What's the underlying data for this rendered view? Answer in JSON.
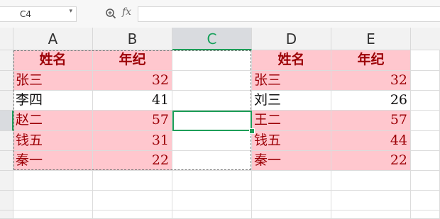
{
  "formula_bar": {
    "name_box": "C4",
    "fx_label": "fx",
    "formula": ""
  },
  "columns": [
    "A",
    "B",
    "C",
    "D",
    "E"
  ],
  "selected_cell": "C4",
  "table_left": {
    "headers": [
      "姓名",
      "年纪"
    ],
    "rows": [
      {
        "name": "张三",
        "age": "32",
        "highlight": true
      },
      {
        "name": "李四",
        "age": "41",
        "highlight": false
      },
      {
        "name": "赵二",
        "age": "57",
        "highlight": true
      },
      {
        "name": "钱五",
        "age": "31",
        "highlight": true
      },
      {
        "name": "秦一",
        "age": "22",
        "highlight": true
      }
    ]
  },
  "table_right": {
    "headers": [
      "姓名",
      "年纪"
    ],
    "rows": [
      {
        "name": "张三",
        "age": "32",
        "highlight": true
      },
      {
        "name": "刘三",
        "age": "26",
        "highlight": false
      },
      {
        "name": "王二",
        "age": "57",
        "highlight": true
      },
      {
        "name": "钱五",
        "age": "44",
        "highlight": true
      },
      {
        "name": "秦一",
        "age": "22",
        "highlight": true
      }
    ]
  },
  "colors": {
    "highlight_fill": "#ffc7ce",
    "highlight_text": "#9c0006",
    "selection": "#1d9e58"
  }
}
